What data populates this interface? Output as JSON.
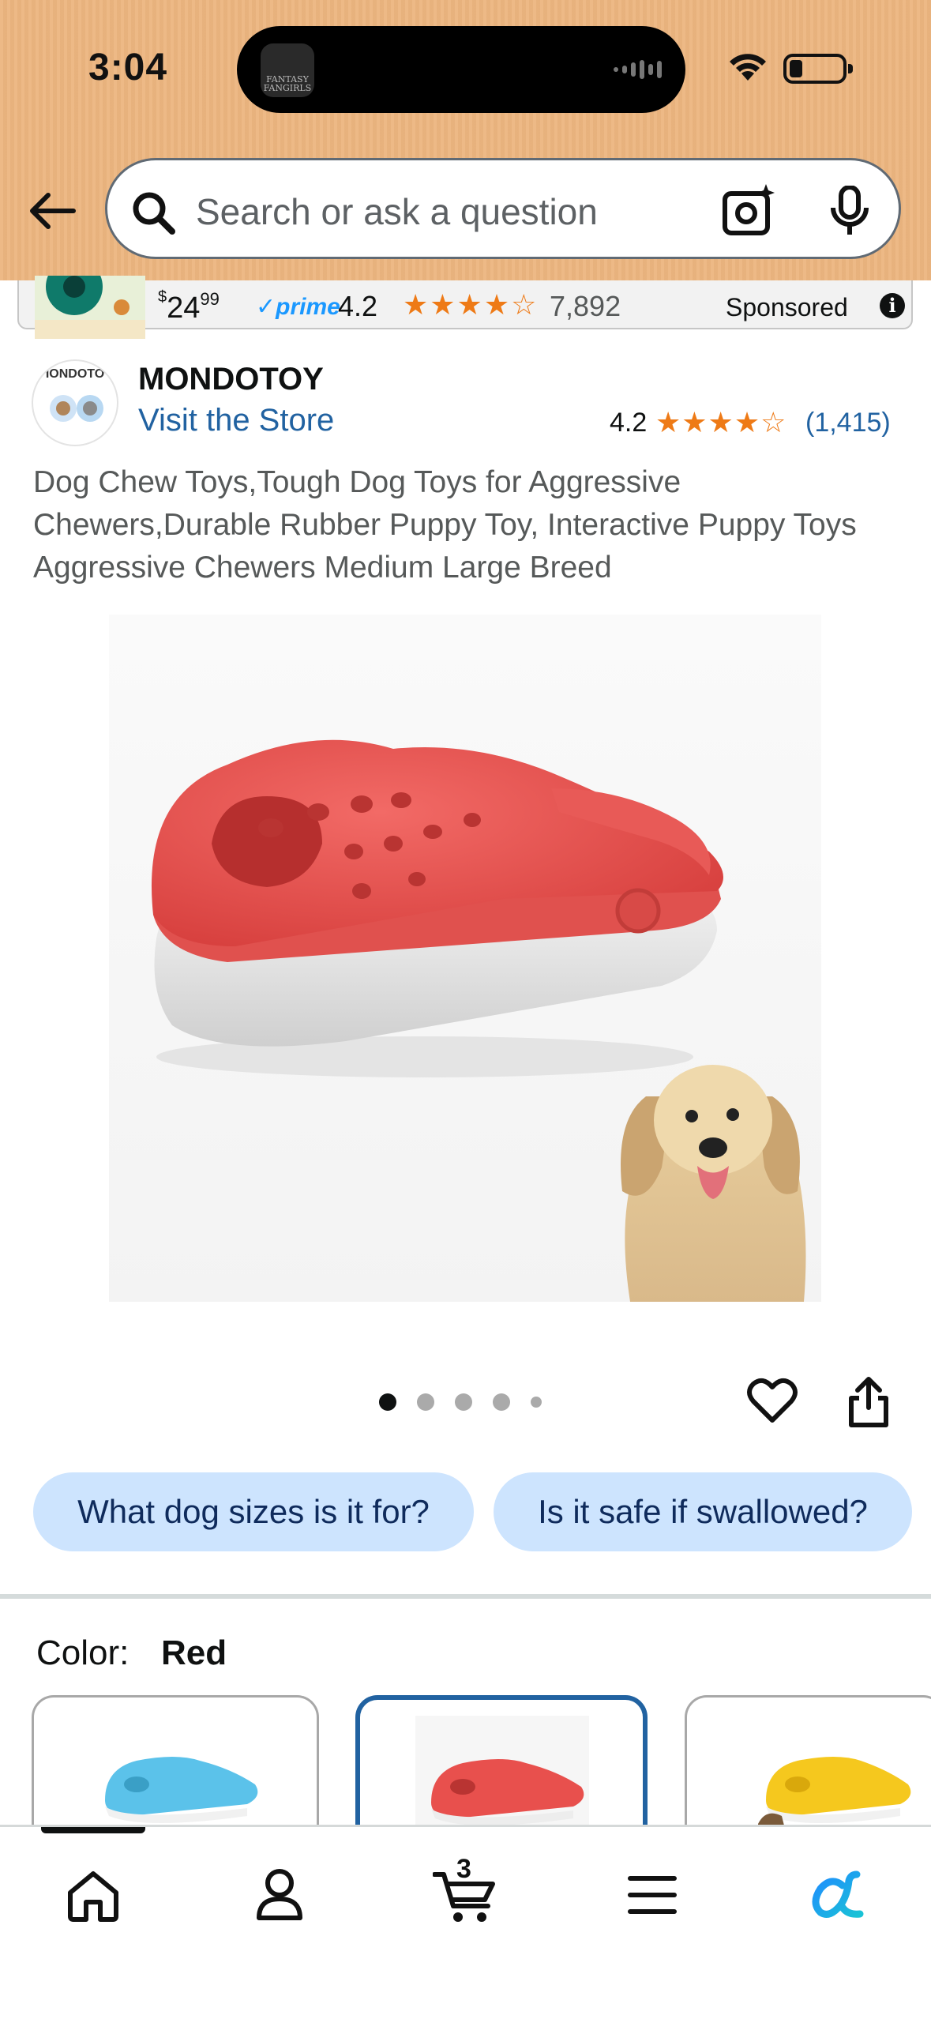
{
  "status_bar": {
    "time": "3:04",
    "island_app_label": "FANTASY FANGIRLS"
  },
  "search": {
    "placeholder": "Search or ask a question",
    "back_icon": "arrow-left-icon",
    "search_icon": "magnifier-icon",
    "camera_icon": "camera-sparkle-icon",
    "mic_icon": "microphone-icon"
  },
  "sponsored": {
    "price_symbol": "$",
    "price_whole": "24",
    "price_cents": "99",
    "prime": "prime",
    "rating": "4.2",
    "stars": "★★★★☆",
    "review_count": "7,892",
    "label": "Sponsored"
  },
  "brand": {
    "logo_text": "IONDOTO",
    "name": "MONDOTOY",
    "visit_store": "Visit the Store",
    "rating": "4.2",
    "stars": "★★★★☆",
    "review_count": "(1,415)"
  },
  "product": {
    "title": "Dog Chew Toys,Tough Dog Toys for Aggressive Chewers,Durable Rubber Puppy Toy, Interactive Puppy Toys Aggressive Chewers Medium Large Breed",
    "image_count": 5,
    "active_image_index": 0
  },
  "questions": [
    "What dog sizes is it for?",
    "Is it safe if swallowed?"
  ],
  "variations": {
    "color_label": "Color:",
    "color_value": "Red",
    "swatches": [
      "Blue",
      "Red",
      "Yellow"
    ],
    "selected_index": 1
  },
  "bottom_nav": {
    "items": [
      "home-icon",
      "account-icon",
      "cart-icon",
      "menu-icon",
      "rufus-icon"
    ],
    "cart_count": "3"
  },
  "colors": {
    "header_bg": "#ecb57f",
    "link_blue": "#2162a1",
    "star_orange": "#ee7a16",
    "chip_bg": "#cde4fe",
    "prime_blue": "#1a98ff"
  }
}
